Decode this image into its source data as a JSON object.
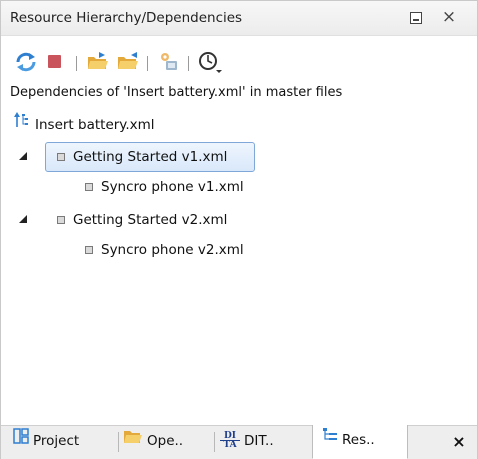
{
  "window": {
    "title": "Resource Hierarchy/Dependencies",
    "close_glyph": "×"
  },
  "toolbar": {
    "buttons": [
      {
        "icon": "refresh-icon"
      },
      {
        "icon": "stop-icon"
      },
      {
        "icon": "show-hierarchy-icon"
      },
      {
        "icon": "show-dependencies-icon"
      },
      {
        "icon": "configure-scope-icon"
      },
      {
        "icon": "history-icon"
      }
    ]
  },
  "info_label": "Dependencies of 'Insert battery.xml' in master files",
  "tree": {
    "root": {
      "label": "Insert battery.xml",
      "icon": "dependency-tree-icon"
    },
    "nodes": [
      {
        "label": "Getting Started v1.xml",
        "expanded": true,
        "selected": true,
        "children": [
          {
            "label": "Syncro phone v1.xml"
          }
        ]
      },
      {
        "label": "Getting Started v2.xml",
        "expanded": true,
        "selected": false,
        "children": [
          {
            "label": "Syncro phone v2.xml"
          }
        ]
      }
    ]
  },
  "bottom_tabs": [
    {
      "label": "Project",
      "icon": "project-icon",
      "active": false
    },
    {
      "label": "Ope..",
      "icon": "open-folder-icon",
      "active": false
    },
    {
      "label": "DIT..",
      "icon": "dita-icon",
      "icon_text_top": "DI",
      "icon_text_bottom": "TA",
      "active": false
    },
    {
      "label": "Res..",
      "icon": "resource-hierarchy-icon",
      "active": true
    }
  ],
  "bottom_close_glyph": "×",
  "colors": {
    "selection_border": "#7fa8d8",
    "selection_fill": "#d9e8fa",
    "folder_yellow": "#f2c14e",
    "refresh_blue": "#2f7fd1",
    "stop_red": "#c9545c"
  }
}
